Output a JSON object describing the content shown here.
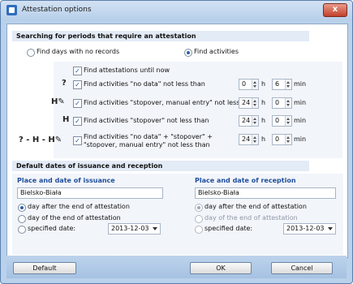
{
  "window": {
    "title": "Attestation options",
    "close_label": "x"
  },
  "search": {
    "header": "Searching for periods that require an attestation",
    "radio_no_records": "Find days with no records",
    "radio_activities": "Find activities",
    "selected": "Find activities",
    "find_until_now": "Find attestations until now",
    "rows": [
      {
        "icon": "?",
        "label": "Find activities \"no data\" not less than",
        "h": "0",
        "min": "6"
      },
      {
        "icon": "H✎",
        "label": "Find activities \"stopover, manual entry\" not less than",
        "h": "24",
        "min": "0"
      },
      {
        "icon": "H",
        "label": "Find activities \"stopover\" not less than",
        "h": "24",
        "min": "0"
      },
      {
        "icon": "? - H - H✎",
        "label": "Find activities \"no data\" + \"stopover\" + \"stopover, manual entry\" not less than",
        "h": "24",
        "min": "0"
      }
    ],
    "unit_h": "h",
    "unit_min": "min"
  },
  "dates": {
    "header": "Default dates of issuance and reception",
    "issuance": {
      "title": "Place and date of issuance",
      "place": "Bielsko-Biała",
      "options": [
        "day after the end of attestation",
        "day of the end of attestation",
        "specified date:"
      ],
      "selected": 0,
      "date": "2013-12-03"
    },
    "reception": {
      "title": "Place and date of reception",
      "place": "Bielsko-Biała",
      "options": [
        "day after the end of attestation",
        "day of the end of attestation",
        "specified date:"
      ],
      "selected": 0,
      "date": "2013-12-03"
    }
  },
  "buttons": {
    "default": "Default",
    "ok": "OK",
    "cancel": "Cancel"
  }
}
